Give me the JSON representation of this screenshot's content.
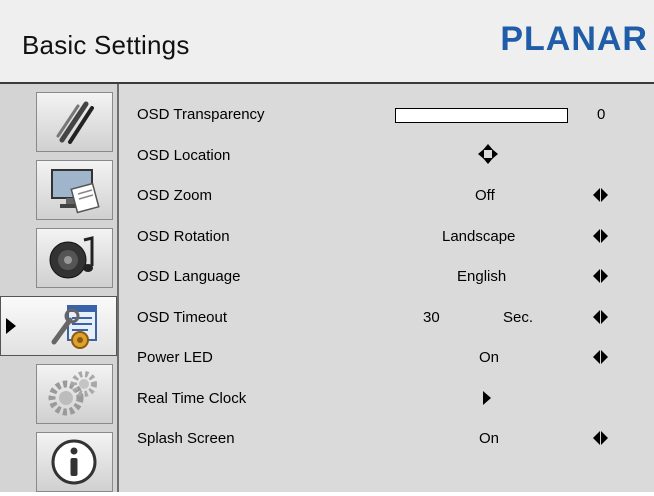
{
  "header": {
    "title": "Basic Settings",
    "brand": "PLANAR"
  },
  "colors": {
    "brand": "#1f5da8",
    "panel": "#dadada",
    "sidebar": "#d4d4d4"
  },
  "sidebar": {
    "items": [
      {
        "icon": "pens-icon"
      },
      {
        "icon": "display-picture-icon"
      },
      {
        "icon": "audio-icon"
      },
      {
        "icon": "tools-settings-icon",
        "selected": true
      },
      {
        "icon": "gears-icon"
      },
      {
        "icon": "info-icon"
      }
    ]
  },
  "settings": {
    "osd_transparency": {
      "label": "OSD Transparency",
      "value": "0",
      "level": 0
    },
    "osd_location": {
      "label": "OSD Location",
      "icon": "four-way-arrow-icon"
    },
    "osd_zoom": {
      "label": "OSD Zoom",
      "value": "Off"
    },
    "osd_rotation": {
      "label": "OSD Rotation",
      "value": "Landscape"
    },
    "osd_language": {
      "label": "OSD Language",
      "value": "English"
    },
    "osd_timeout": {
      "label": "OSD Timeout",
      "value": "30",
      "unit": "Sec."
    },
    "power_led": {
      "label": "Power LED",
      "value": "On"
    },
    "real_time_clock": {
      "label": "Real Time Clock",
      "icon": "submenu-arrow-icon"
    },
    "splash_screen": {
      "label": "Splash Screen",
      "value": "On"
    }
  }
}
